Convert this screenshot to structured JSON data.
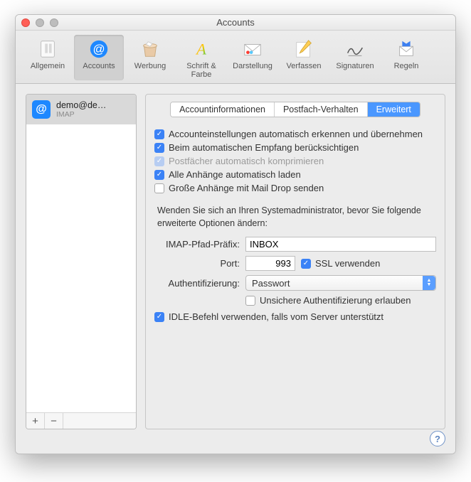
{
  "window": {
    "title": "Accounts"
  },
  "toolbar": {
    "items": [
      {
        "id": "general",
        "label": "Allgemein"
      },
      {
        "id": "accounts",
        "label": "Accounts"
      },
      {
        "id": "junk",
        "label": "Werbung"
      },
      {
        "id": "fonts",
        "label": "Schrift & Farbe"
      },
      {
        "id": "viewing",
        "label": "Darstellung"
      },
      {
        "id": "composing",
        "label": "Verfassen"
      },
      {
        "id": "signatures",
        "label": "Signaturen"
      },
      {
        "id": "rules",
        "label": "Regeln"
      }
    ],
    "active": "accounts"
  },
  "sidebar": {
    "accounts": [
      {
        "name": "demo@de…",
        "type": "IMAP"
      }
    ],
    "add": "+",
    "remove": "−"
  },
  "tabs": {
    "items": [
      {
        "id": "info",
        "label": "Accountinformationen"
      },
      {
        "id": "mailbox",
        "label": "Postfach-Verhalten"
      },
      {
        "id": "advanced",
        "label": "Erweitert"
      }
    ],
    "selected": "advanced"
  },
  "settings": {
    "auto_detect": {
      "checked": true,
      "label": "Accounteinstellungen automatisch erkennen und übernehmen"
    },
    "auto_receive": {
      "checked": true,
      "label": "Beim automatischen Empfang berücksichtigen"
    },
    "auto_compress": {
      "checked": true,
      "disabled": true,
      "label": "Postfächer automatisch komprimieren"
    },
    "auto_attach": {
      "checked": true,
      "label": "Alle Anhänge automatisch laden"
    },
    "maildrop": {
      "checked": false,
      "label": "Große Anhänge mit Mail Drop senden"
    },
    "note": "Wenden Sie sich an Ihren Systemadministrator, bevor Sie folgende erweiterte Optionen ändern:",
    "imap_prefix": {
      "label": "IMAP-Pfad-Präfix:",
      "value": "INBOX"
    },
    "port": {
      "label": "Port:",
      "value": "993"
    },
    "ssl": {
      "checked": true,
      "label": "SSL verwenden"
    },
    "auth": {
      "label": "Authentifizierung:",
      "value": "Passwort"
    },
    "insecure": {
      "checked": false,
      "label": "Unsichere Authentifizierung erlauben"
    },
    "idle": {
      "checked": true,
      "label": "IDLE-Befehl verwenden, falls vom Server unterstützt"
    }
  },
  "help": "?"
}
